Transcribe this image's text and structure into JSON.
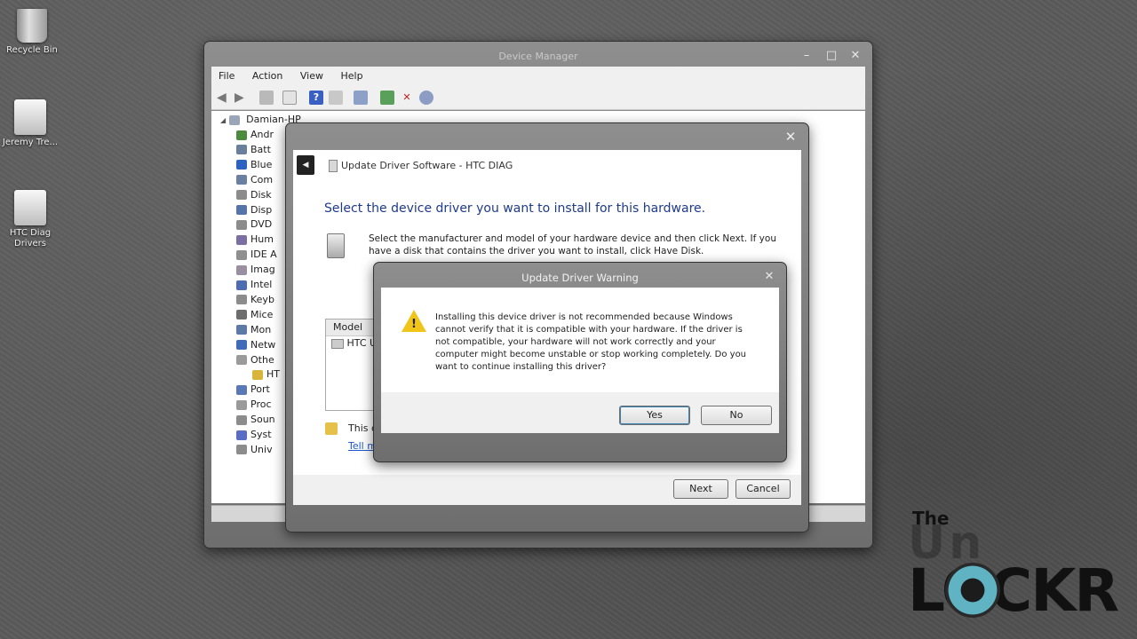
{
  "desktop": {
    "icons": [
      {
        "label": "Recycle Bin"
      },
      {
        "label": "Jeremy Tre..."
      },
      {
        "label": "HTC Diag Drivers"
      }
    ]
  },
  "device_manager": {
    "title": "Device Manager",
    "menu": [
      "File",
      "Action",
      "View",
      "Help"
    ],
    "tree": {
      "root": "Damian-HP",
      "items": [
        "Andr",
        "Batt",
        "Blue",
        "Com",
        "Disk",
        "Disp",
        "DVD",
        "Hum",
        "IDE A",
        "Imag",
        "Intel",
        "Keyb",
        "Mice",
        "Mon",
        "Netw",
        "Othe",
        "HT",
        "Port",
        "Proc",
        "Soun",
        "Syst",
        "Univ"
      ]
    }
  },
  "update_driver": {
    "title": "Update Driver Software - HTC DIAG",
    "heading": "Select the device driver you want to install for this hardware.",
    "description": "Select the manufacturer and model of your hardware device and then click Next. If you have a disk that contains the driver you want to install, click Have Disk.",
    "model_header": "Model",
    "model_item": "HTC US",
    "signed_note": "This d",
    "link": "Tell m",
    "next_label": "Next",
    "cancel_label": "Cancel"
  },
  "warning": {
    "title": "Update Driver Warning",
    "message": "Installing this device driver is not recommended because Windows cannot verify that it is compatible with your hardware. If the driver is not compatible, your hardware will not work correctly and your computer might become unstable or stop working completely. Do you want to continue installing this driver?",
    "yes_label": "Yes",
    "no_label": "No"
  },
  "watermark": {
    "line1": "The",
    "line2": "Un",
    "line3": "LOCKR"
  }
}
